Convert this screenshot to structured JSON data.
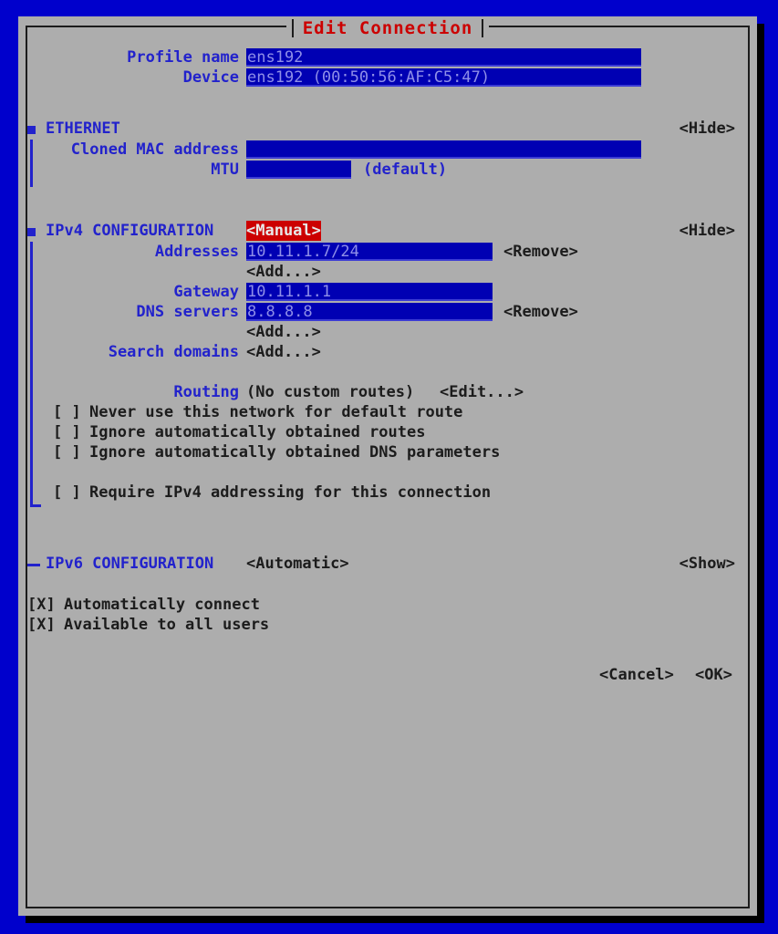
{
  "window": {
    "title": "Edit Connection",
    "title_color": "#cc0000",
    "backdrop_color": "#0000cc",
    "dialog_color": "#adadad",
    "field_color": "#0000b3",
    "accent_color": "#2222cc",
    "selected_color": "#cc0000"
  },
  "profile": {
    "name_label": "Profile name",
    "name_value": "ens192_",
    "device_label": "Device",
    "device_value": "ens192 (00:50:56:AF:C5:47)_"
  },
  "ethernet": {
    "marker": "square-marker",
    "title": "ETHERNET",
    "toggle": "<Hide>",
    "cloned_mac_label": "Cloned MAC address",
    "cloned_mac_value": "",
    "mtu_label": "MTU",
    "mtu_value": "",
    "mtu_hint": "(default)"
  },
  "ipv4": {
    "marker": "square-marker",
    "title": "IPv4 CONFIGURATION",
    "mode": "<Manual>",
    "mode_selected": true,
    "toggle": "<Hide>",
    "addresses_label": "Addresses",
    "addresses_value": "10.11.1.7/24_",
    "addresses_remove": "<Remove>",
    "addresses_add": "<Add...>",
    "gateway_label": "Gateway",
    "gateway_value": "10.11.1.1_",
    "dns_label": "DNS servers",
    "dns_value": "8.8.8.8_",
    "dns_remove": "<Remove>",
    "dns_add": "<Add...>",
    "search_domains_label": "Search domains",
    "search_domains_add": "<Add...>",
    "routing_label": "Routing",
    "routing_value": "(No custom routes)",
    "routing_edit": "<Edit...>",
    "checkboxes": [
      {
        "box": "[ ]",
        "checked": false,
        "label": "Never use this network for default route"
      },
      {
        "box": "[ ]",
        "checked": false,
        "label": "Ignore automatically obtained routes"
      },
      {
        "box": "[ ]",
        "checked": false,
        "label": "Ignore automatically obtained DNS parameters"
      }
    ],
    "require_checkbox": {
      "box": "[ ]",
      "checked": false,
      "label": "Require IPv4 addressing for this connection"
    }
  },
  "ipv6": {
    "marker": "dash-marker",
    "title": "IPv6 CONFIGURATION",
    "mode": "<Automatic>",
    "toggle": "<Show>"
  },
  "options": [
    {
      "box": "[X]",
      "checked": true,
      "label": "Automatically connect"
    },
    {
      "box": "[X]",
      "checked": true,
      "label": "Available to all users"
    }
  ],
  "actions": {
    "cancel": "<Cancel>",
    "ok": "<OK>"
  }
}
